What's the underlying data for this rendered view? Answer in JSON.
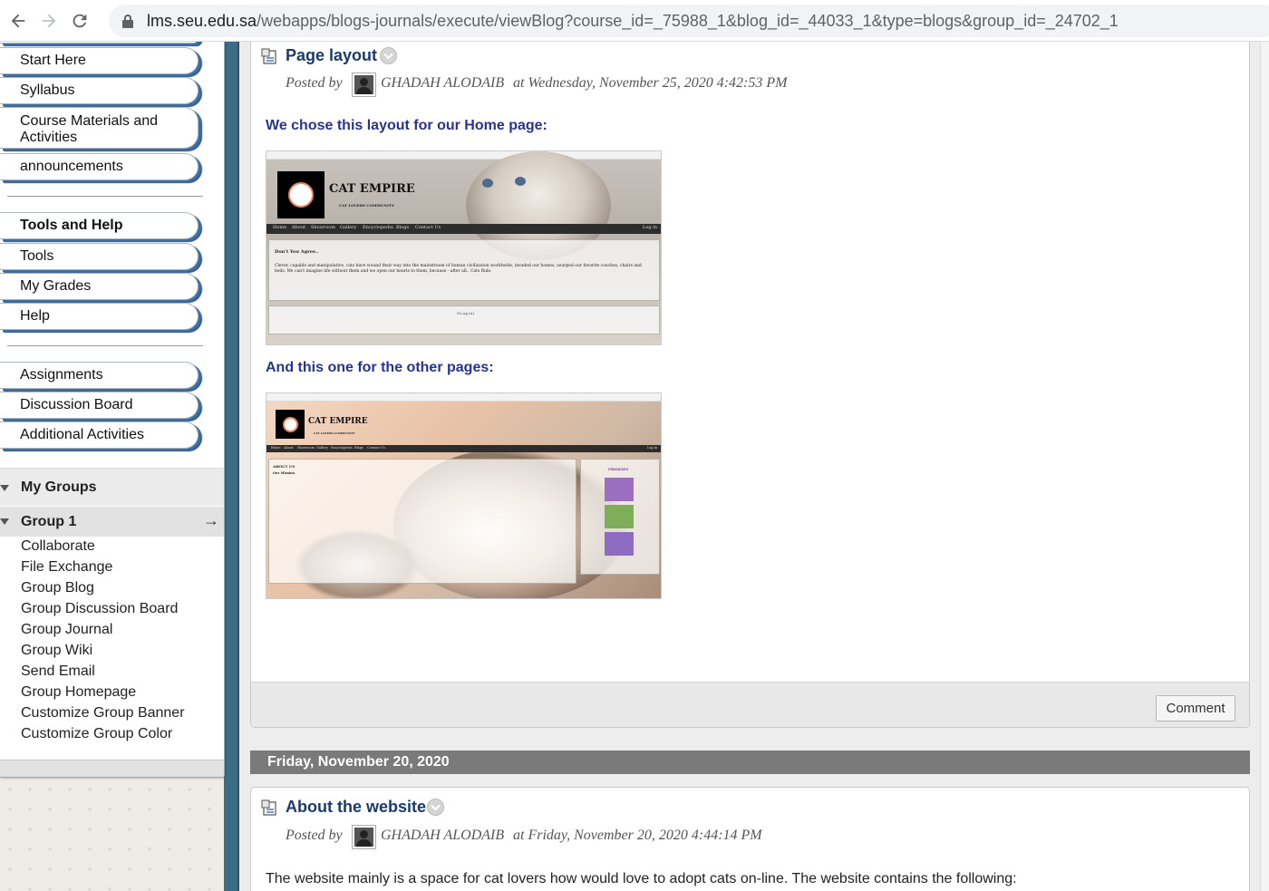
{
  "browser": {
    "url_host": "lms.seu.edu.sa",
    "url_path": "/webapps/blogs-journals/execute/viewBlog?course_id=_75988_1&blog_id=_44033_1&type=blogs&group_id=_24702_1"
  },
  "sidebar": {
    "course_links": [
      "Start Here",
      "Syllabus",
      "Course Materials and Activities",
      "announcements"
    ],
    "tools_heading": "Tools and Help",
    "tools_links": [
      "Tools",
      "My Grades",
      "Help"
    ],
    "activity_links": [
      "Assignments",
      "Discussion Board",
      "Additional Activities"
    ],
    "my_groups": {
      "title": "My Groups",
      "group_name": "Group 1",
      "arrow": "→",
      "links": [
        "Collaborate",
        "File Exchange",
        "Group Blog",
        "Group Discussion Board",
        "Group Journal",
        "Group Wiki",
        "Send Email",
        "Group Homepage",
        "Customize Group Banner",
        "Customize Group Color"
      ]
    }
  },
  "posts": [
    {
      "title": "Page layout",
      "posted_by_label": "Posted by",
      "author": "GHADAH ALODAIB",
      "timestamp": "at Wednesday, November 25, 2020 4:42:53 PM",
      "heading1": "We chose this layout for our Home page:",
      "heading2": "And this one for the other pages:",
      "comment_label": "Comment"
    },
    {
      "date_header": "Friday, November 20, 2020",
      "title": "About the website",
      "posted_by_label": "Posted by",
      "author": "GHADAH ALODAIB",
      "timestamp": "at Friday, November 20, 2020 4:44:14 PM",
      "body": "The website mainly is a space for cat lovers how would love to adopt cats on-line. The website contains the following:"
    }
  ],
  "thumbnails": {
    "home": {
      "brand": "CAT EMPIRE",
      "tagline": "CAT LOVERS COMMUNITY",
      "nav": [
        "Home",
        "About",
        "Showroom",
        "Gallery",
        "Encyclopedia",
        "Blogs",
        "Contact Us"
      ],
      "login": "Log in",
      "panel_title": "Don't You Agree..",
      "panel_text": "Clever, capable and manipulative, cats have wound their way into the mainstream of human civilization worldwide, invaded our homes, usurped our favorite couches, chairs and beds. We can't imagine life without them and we open our hearts to them, because - after all.. Cats Rule.",
      "footer_link": "Go up (n)"
    },
    "other": {
      "brand": "CAT EMPIRE",
      "tagline": "CAT LOVERS COMMUNITY",
      "nav": [
        "Home",
        "About",
        "Showroom",
        "Gallery",
        "Encyclopedia",
        "Blogs",
        "Contact Us"
      ],
      "login": "Log in",
      "section_title": "ABOUT US",
      "section_sub": "Our Mission",
      "side_title": "FRISKIES"
    }
  }
}
